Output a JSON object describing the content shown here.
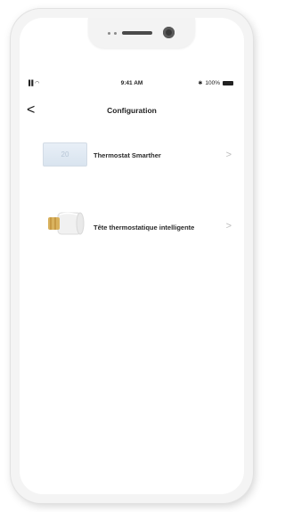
{
  "status": {
    "signal": "▌▌ ◠",
    "time": "9:41 AM",
    "battery_pct": "100%"
  },
  "nav": {
    "back_icon": "chevron-left-icon",
    "back_glyph": "<",
    "title": "Configuration"
  },
  "devices": [
    {
      "label": "Thermostat Smarther",
      "image_text": "20"
    },
    {
      "label": "Tête thermostatique intelligente"
    }
  ],
  "chevron_glyph": ">",
  "colors": {
    "accent": "#2a2a2a",
    "chevron": "#bdbdbd"
  }
}
